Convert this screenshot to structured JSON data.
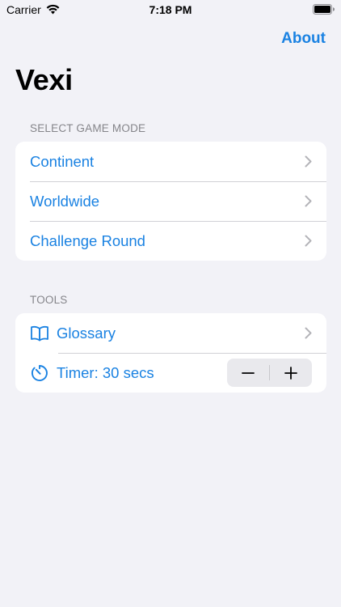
{
  "status_bar": {
    "carrier": "Carrier",
    "time": "7:18 PM"
  },
  "nav": {
    "about_label": "About"
  },
  "title": "Vexi",
  "game_mode_section": {
    "header": "SELECT GAME MODE",
    "items": [
      {
        "label": "Continent"
      },
      {
        "label": "Worldwide"
      },
      {
        "label": "Challenge Round"
      }
    ]
  },
  "tools_section": {
    "header": "TOOLS",
    "glossary": {
      "label": "Glossary",
      "icon": "book-icon"
    },
    "timer": {
      "label": "Timer: 30 secs",
      "icon": "timer-icon"
    }
  },
  "colors": {
    "accent": "#1a82e2",
    "background": "#f2f2f7",
    "card": "#ffffff",
    "secondary_text": "#85858a"
  }
}
